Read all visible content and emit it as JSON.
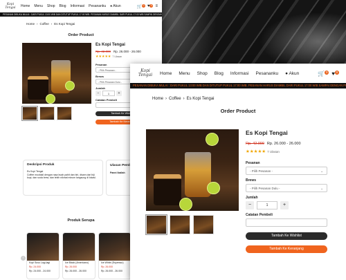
{
  "site": {
    "logo_text": "Kopi Tengai",
    "nav": [
      "Home",
      "Menu",
      "Shop",
      "Blog",
      "Informasi",
      "Pesananku"
    ],
    "account_label": "Akun",
    "cart_count": "0",
    "wishlist_count": "0",
    "ticker": "PESANAN DIBUKA MULAI : DARI PUKUL 13:00 WIB DAN DITUTUP PUKUL 17:00 WIB. PESANAN HARUS DIAMBIL DARI PUKUL 17:00 WIB SAMPAI DENGAN PUKUL 20:00 WIB"
  },
  "breadcrumb": [
    "Home",
    "Coffee",
    "Es Kopi Tengai"
  ],
  "section_title": "Order Product",
  "product": {
    "name": "Es Kopi Tengai",
    "old_price": "Rp. 42.000",
    "price_range": "Rp. 26.000 - 26.000",
    "stars": "★★★★★",
    "reviews": "7 Ulasan",
    "pesanan_label": "Pesanan",
    "pesanan_value": "- Pilih Pesanan -",
    "brews_label": "Brews",
    "brews_value": "- Pilih Pesanan Dulu -",
    "qty_label": "Jumlah",
    "qty": "1",
    "note_label": "Catatan Pembeli",
    "wishlist_button": "Tambah Ke Wishlist",
    "cart_button": "Tambah Ke Keranjang"
  },
  "description": {
    "title": "Deskripsi Produk",
    "text": "Es Kopi Tengai\nCoffee mocktail dengan rasa buah pahit dan biri, disam dari biji kopi, dan soda brew, dan lebih nikmat minum langsung di lokasi."
  },
  "review": {
    "title": "Ulasan Pembeli",
    "user": "Panni Iballah"
  },
  "related": {
    "title": "Produk Serupa",
    "items": [
      {
        "name": "Kopi Susu Lagi-lagi",
        "price": "Rp. 24.000",
        "range": "Rp. 24.000 - 24.000"
      },
      {
        "name": "Ice Black (Americano)",
        "price": "Rp. 26.000",
        "range": "Rp. 26.000 - 26.000"
      },
      {
        "name": "Ice White (Espresso)",
        "price": "Rp. 26.000",
        "range": "Rp. 26.000 - 26.000"
      }
    ]
  }
}
